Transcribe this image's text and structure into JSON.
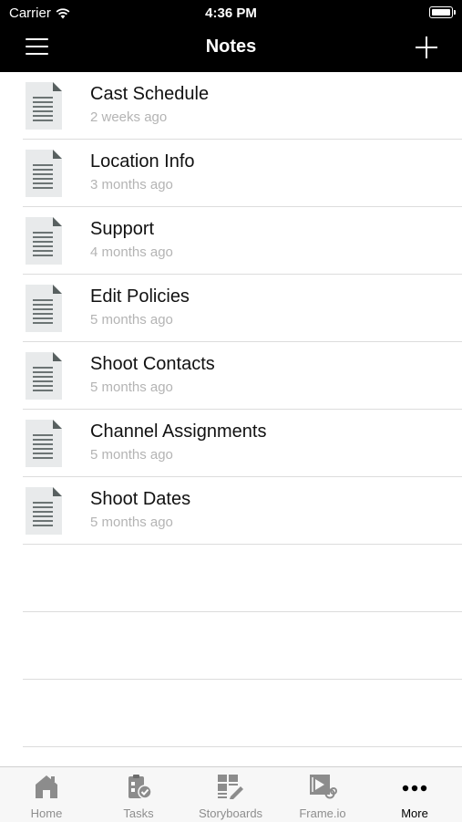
{
  "status_bar": {
    "carrier": "Carrier",
    "time": "4:36 PM"
  },
  "header": {
    "title": "Notes",
    "menu_icon": "hamburger-menu-icon",
    "add_icon": "plus-icon"
  },
  "notes": [
    {
      "title": "Cast Schedule",
      "subtitle": "2 weeks ago"
    },
    {
      "title": "Location Info",
      "subtitle": "3 months ago"
    },
    {
      "title": "Support",
      "subtitle": "4 months ago"
    },
    {
      "title": "Edit Policies",
      "subtitle": "5 months ago"
    },
    {
      "title": "Shoot Contacts",
      "subtitle": "5 months ago"
    },
    {
      "title": "Channel Assignments",
      "subtitle": "5 months ago"
    },
    {
      "title": "Shoot Dates",
      "subtitle": "5 months ago"
    }
  ],
  "tabs": [
    {
      "label": "Home",
      "icon": "home-icon",
      "active": false
    },
    {
      "label": "Tasks",
      "icon": "tasks-icon",
      "active": false
    },
    {
      "label": "Storyboards",
      "icon": "storyboards-icon",
      "active": false
    },
    {
      "label": "Frame.io",
      "icon": "frameio-icon",
      "active": false
    },
    {
      "label": "More",
      "icon": "more-dots-icon",
      "active": true
    }
  ],
  "colors": {
    "header_bg": "#000000",
    "subtitle": "#b4b4b4",
    "divider": "#dcdcdc",
    "tab_inactive": "#8e8e8e"
  }
}
